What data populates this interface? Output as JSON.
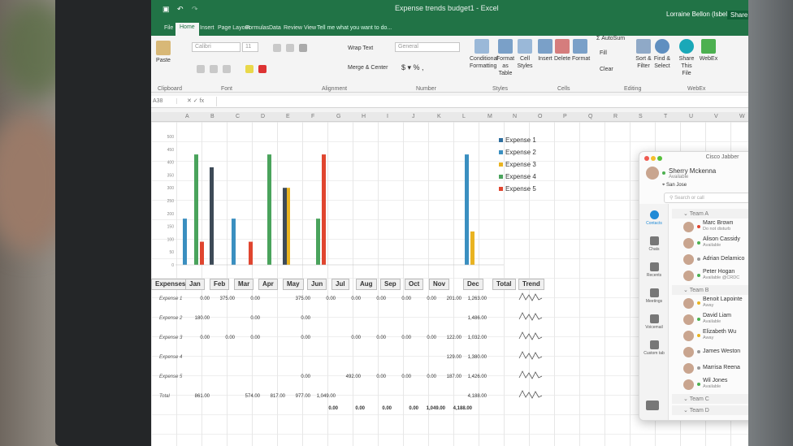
{
  "excel": {
    "title": "Expense trends budget1 - Excel",
    "user": "Lorraine Bellon (lsbellon)",
    "share": "Share",
    "tabs": [
      "File",
      "Home",
      "Insert",
      "Page Layout",
      "Formulas",
      "Data",
      "Review",
      "View"
    ],
    "tell_me": "Tell me what you want to do...",
    "ribbon": {
      "font_name": "Calibri",
      "font_size": "11",
      "number_format": "General",
      "wrap_text": "Wrap Text",
      "merge_center": "Merge & Center",
      "paste": "Paste",
      "conditional": "Conditional Formatting",
      "format_table": "Format as Table",
      "cell_styles": "Cell Styles",
      "insert": "Insert",
      "delete": "Delete",
      "format": "Format",
      "autosum": "AutoSum",
      "fill": "Fill",
      "clear": "Clear",
      "sort": "Sort & Filter",
      "find": "Find & Select",
      "share_file": "Share This File",
      "webex": "WebEx",
      "groups": {
        "clipboard": "Clipboard",
        "font": "Font",
        "alignment": "Alignment",
        "number": "Number",
        "styles": "Styles",
        "cells": "Cells",
        "editing": "Editing",
        "webex": "WebEx"
      }
    },
    "name_box": "A38",
    "columns": [
      "A",
      "B",
      "C",
      "D",
      "E",
      "F",
      "G",
      "H",
      "I",
      "J",
      "K",
      "L",
      "M",
      "N",
      "O",
      "P",
      "Q",
      "R",
      "S",
      "T",
      "U",
      "V",
      "W"
    ],
    "table": {
      "headers": [
        "Expenses",
        "Jan",
        "Feb",
        "Mar",
        "Apr",
        "May",
        "Jun",
        "Jul",
        "Aug",
        "Sep",
        "Oct",
        "Nov",
        "Dec",
        "Total",
        "Trend"
      ],
      "rows": [
        {
          "label": "Expense 1",
          "values": [
            "0.00",
            "375.00",
            "0.00",
            "",
            "375.00",
            "0.00",
            "0.00",
            "0.00",
            "0.00",
            "0.00",
            "201.00",
            "1,263.00"
          ]
        },
        {
          "label": "Expense 2",
          "values": [
            "180.00",
            "",
            "0.00",
            "",
            "0.00",
            "",
            "",
            "",
            "",
            "",
            "",
            "1,486.00"
          ]
        },
        {
          "label": "Expense 3",
          "values": [
            "0.00",
            "0.00",
            "0.00",
            "",
            "0.00",
            "",
            "0.00",
            "0.00",
            "0.00",
            "0.00",
            "122.00",
            "1,032.00"
          ]
        },
        {
          "label": "Expense 4",
          "values": [
            "",
            "",
            "",
            "",
            "",
            "",
            "",
            "",
            "",
            "",
            "129.00",
            "1,380.00"
          ]
        },
        {
          "label": "Expense 5",
          "values": [
            "",
            "",
            "",
            "",
            "0.00",
            "",
            "492.00",
            "0.00",
            "0.00",
            "0.00",
            "187.00",
            "1,426.00"
          ]
        },
        {
          "label": "Total",
          "values": [
            "861.00",
            "",
            "574.00",
            "817.00",
            "977.00",
            "1,049.00",
            "",
            "",
            "",
            "",
            "",
            "4,188.00"
          ]
        }
      ],
      "bottom_row": [
        "0.00",
        "0.00",
        "0.00",
        "0.00",
        "1,049.00",
        "4,188.00"
      ]
    }
  },
  "chart_data": {
    "type": "bar",
    "categories": [
      "Jan",
      "Feb",
      "Mar",
      "Apr",
      "May",
      "Jun",
      "Dec"
    ],
    "ylim": [
      0,
      500
    ],
    "y_ticks": [
      "500",
      "450",
      "400",
      "350",
      "300",
      "250",
      "200",
      "150",
      "100",
      "50",
      "0"
    ],
    "legend_position": "right",
    "series": [
      {
        "name": "Expense 1",
        "color": "#2e6e9e",
        "values": [
          0,
          0,
          0,
          0,
          0,
          0,
          0
        ]
      },
      {
        "name": "Expense 2",
        "color": "#3a8fc0",
        "values": [
          180,
          0,
          180,
          0,
          0,
          0,
          430
        ]
      },
      {
        "name": "Expense 3",
        "color": "#e9b321",
        "values": [
          0,
          0,
          0,
          0,
          300,
          0,
          130
        ]
      },
      {
        "name": "Expense 4",
        "color": "#4aa35c",
        "values": [
          430,
          0,
          0,
          430,
          0,
          180,
          0
        ]
      },
      {
        "name": "Expense 5",
        "color": "#e0452f",
        "values": [
          90,
          0,
          90,
          0,
          0,
          430,
          0
        ]
      }
    ],
    "series_extra": [
      {
        "name": "Expense 1",
        "color": "#3d4a57",
        "values": [
          0,
          380,
          0,
          0,
          300,
          0,
          0
        ]
      }
    ]
  },
  "jabber": {
    "title": "Cisco Jabber",
    "me": {
      "name": "Sherry Mckenna",
      "status": "Available",
      "location": "San Jose"
    },
    "search_placeholder": "Search or call",
    "nav": [
      "Contacts",
      "Chats",
      "Recents",
      "Meetings",
      "Voicemail",
      "Custom tab"
    ],
    "teams": [
      {
        "name": "Team A",
        "contacts": [
          {
            "name": "Marc Brown",
            "status": "Do not disturb",
            "color": "#e0452f"
          },
          {
            "name": "Alison Cassidy",
            "status": "Available",
            "color": "#4cb050"
          },
          {
            "name": "Adrian Delamico",
            "status": "",
            "color": "#9a9a9a"
          },
          {
            "name": "Peter Hogan",
            "status": "Available @CRDC",
            "color": "#4cb050"
          }
        ]
      },
      {
        "name": "Team B",
        "contacts": [
          {
            "name": "Benoit Lapointe",
            "status": "Away",
            "color": "#e9b321"
          },
          {
            "name": "David Liam",
            "status": "Available",
            "color": "#4cb050"
          },
          {
            "name": "Elizabeth Wu",
            "status": "Away",
            "color": "#e9b321"
          },
          {
            "name": "James Weston",
            "status": "",
            "color": "#9a9a9a"
          },
          {
            "name": "Marrisa Reena",
            "status": "",
            "color": "#9a9a9a"
          },
          {
            "name": "Wil Jones",
            "status": "Available",
            "color": "#4cb050"
          }
        ]
      },
      {
        "name": "Team C",
        "contacts": []
      },
      {
        "name": "Team D",
        "contacts": []
      }
    ]
  }
}
